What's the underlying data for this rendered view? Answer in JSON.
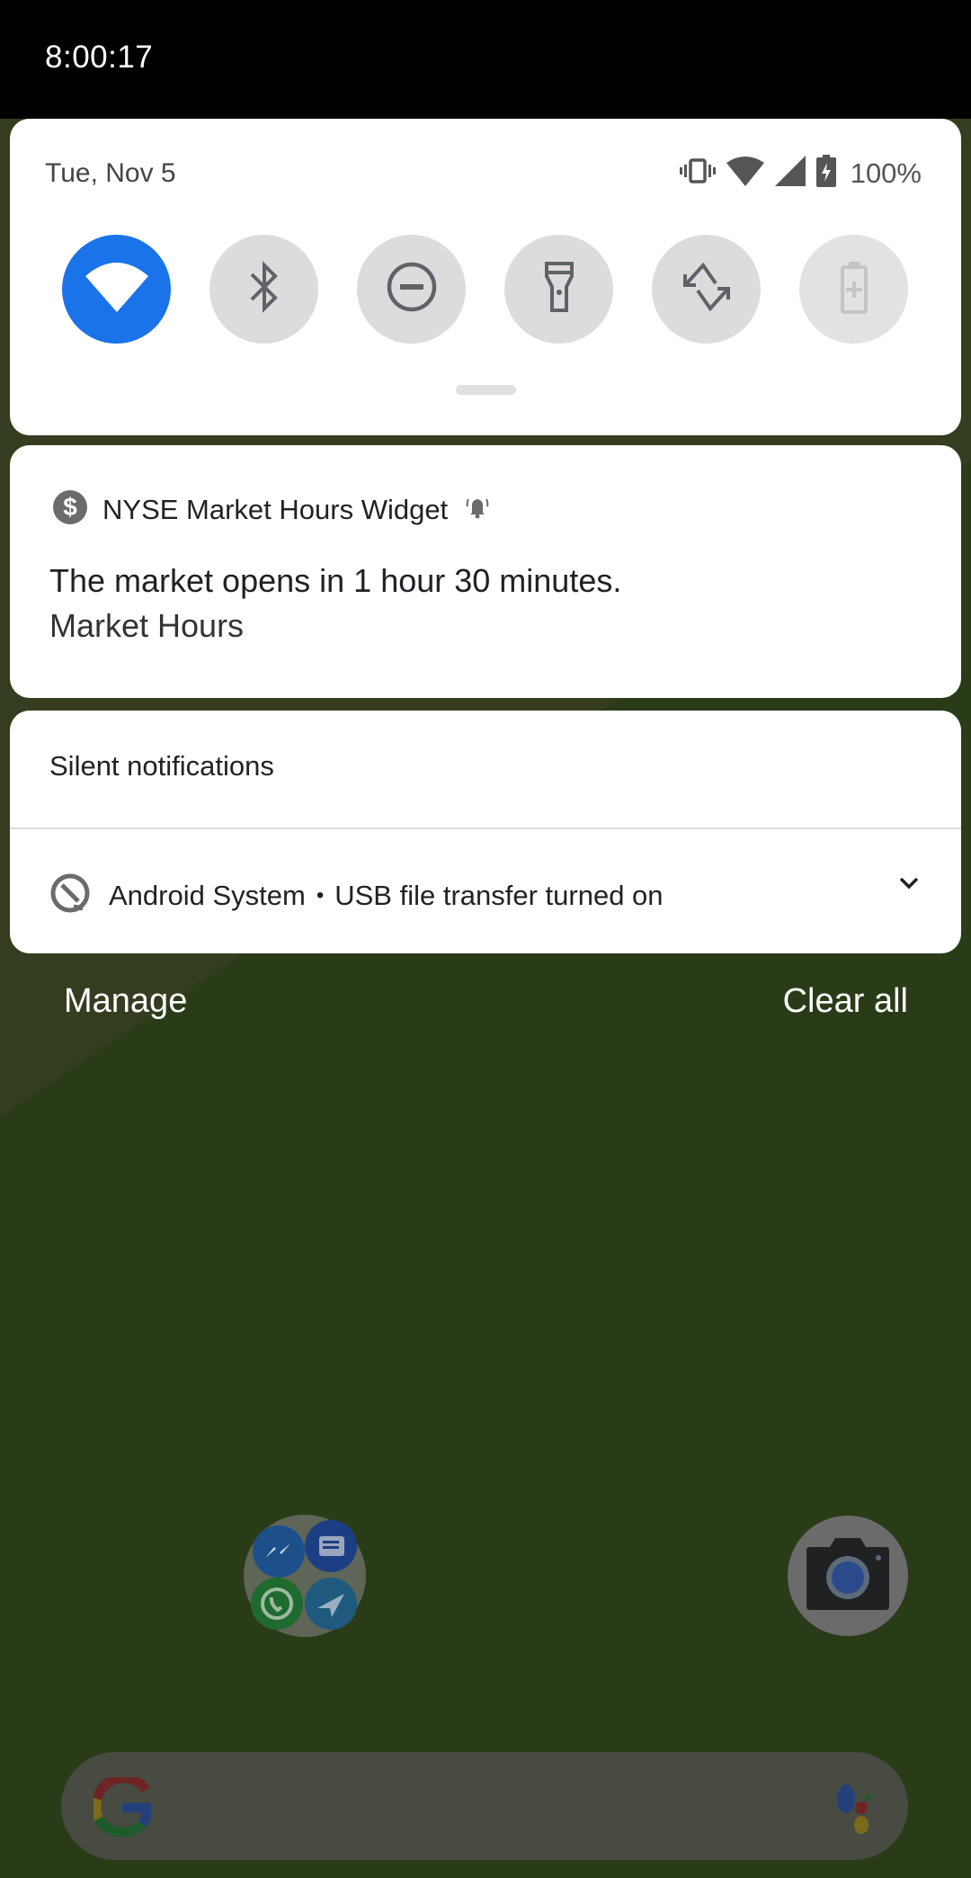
{
  "status_bar": {
    "time": "8:00:17"
  },
  "quick_settings": {
    "date": "Tue, Nov 5",
    "battery_percent": "100%",
    "status_icons": [
      "vibrate-icon",
      "wifi-signal-icon",
      "cell-signal-icon",
      "battery-charging-icon"
    ],
    "tiles": [
      {
        "name": "wifi",
        "icon": "wifi-icon",
        "state": "on"
      },
      {
        "name": "bluetooth",
        "icon": "bluetooth-icon",
        "state": "off"
      },
      {
        "name": "do-not-disturb",
        "icon": "do-not-disturb-icon",
        "state": "off"
      },
      {
        "name": "flashlight",
        "icon": "flashlight-icon",
        "state": "off"
      },
      {
        "name": "auto-rotate",
        "icon": "auto-rotate-icon",
        "state": "off"
      },
      {
        "name": "battery-saver",
        "icon": "battery-saver-icon",
        "state": "disabled"
      }
    ]
  },
  "notifications": [
    {
      "app_name": "NYSE Market Hours Widget",
      "app_icon": "dollar-icon",
      "alerting_icon": "bell-icon",
      "title": "The market opens in 1 hour 30 minutes.",
      "text": "Market Hours"
    }
  ],
  "silent_section": {
    "header": "Silent notifications",
    "items": [
      {
        "app_name": "Android System",
        "separator": "•",
        "text": "USB file transfer turned on",
        "app_icon": "android-q-icon",
        "expand_icon": "chevron-down-icon"
      }
    ]
  },
  "footer": {
    "manage_label": "Manage",
    "clear_all_label": "Clear all"
  },
  "home": {
    "folder_apps": [
      "messenger",
      "messages",
      "whatsapp",
      "telegram"
    ],
    "dock_apps": [
      "camera"
    ],
    "search_bar": {
      "left_logo": "google-g-icon",
      "right_logo": "assistant-icon"
    }
  },
  "colors": {
    "accent": "#1a73e8",
    "tile_off": "#dcdcdc",
    "wallpaper": "#2a3b18"
  }
}
